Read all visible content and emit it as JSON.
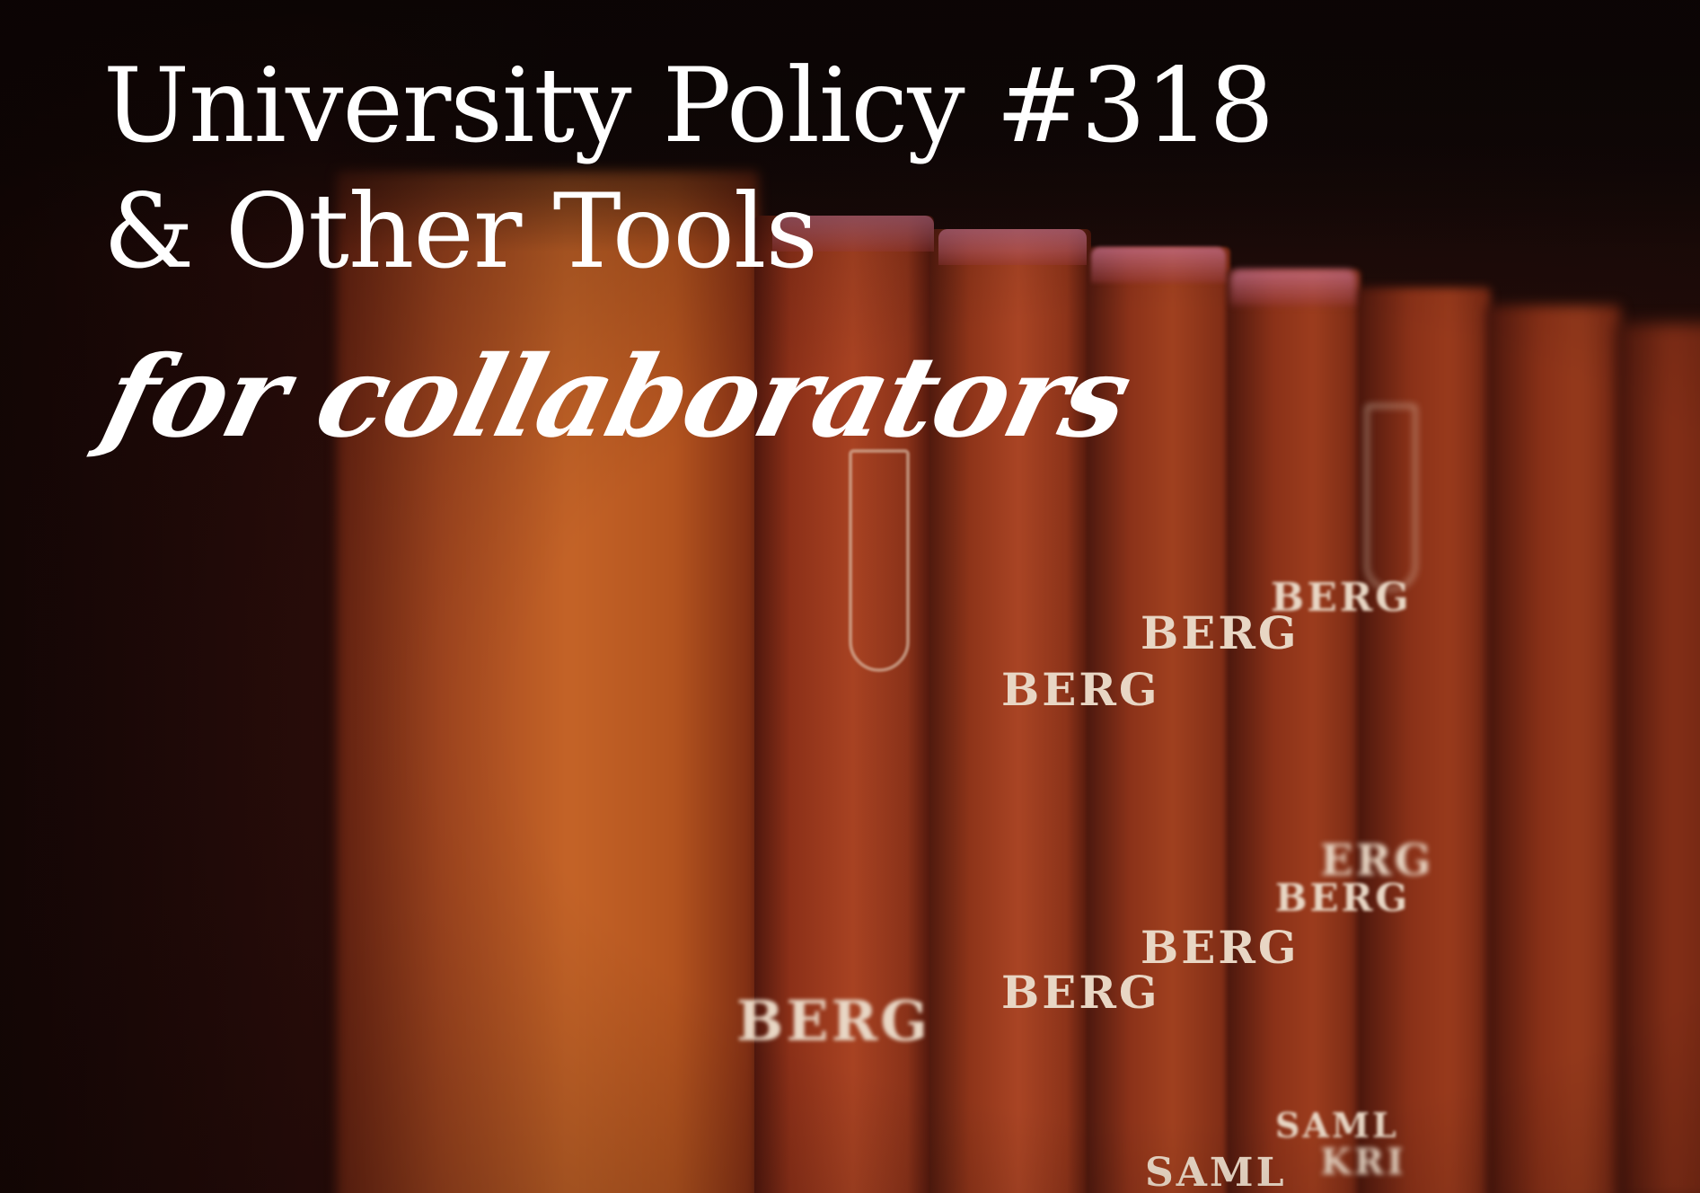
{
  "image": {
    "title_line_1": "University Policy #318",
    "title_line_2": "& Other Tools",
    "subtitle": "for collaborators",
    "spine_labels": {
      "book_1": "BERG",
      "book_2_upper": "BERG",
      "book_2_lower": "BERG",
      "book_3_upper": "BERG",
      "book_3_middle": "BERG",
      "book_3_lower": "SAML",
      "book_4_upper": "BERG",
      "book_4_lower": "BERG",
      "book_4_bottom": "SAML",
      "book_5_upper": "ERG",
      "book_5_lower": "KRI"
    }
  }
}
